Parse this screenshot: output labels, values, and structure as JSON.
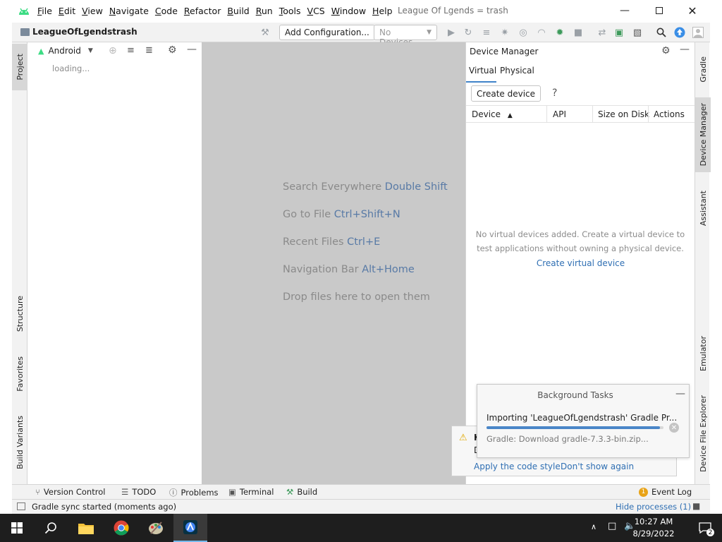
{
  "window": {
    "title": "League Of Lgends = trash",
    "menu": [
      "File",
      "Edit",
      "View",
      "Navigate",
      "Code",
      "Refactor",
      "Build",
      "Run",
      "Tools",
      "VCS",
      "Window",
      "Help"
    ],
    "min_icon": "minimize-icon",
    "max_icon": "maximize-icon",
    "close_icon": "close-icon"
  },
  "toolbar": {
    "project_name": "LeagueOfLgendstrash",
    "add_configuration": "Add Configuration...",
    "device_selector": "No Devices"
  },
  "left_stripe": {
    "project_tab": "Project",
    "structure_tab": "Structure",
    "favorites_tab": "Favorites",
    "build_variants_tab": "Build Variants"
  },
  "project_panel": {
    "view_mode": "Android",
    "loading": "loading..."
  },
  "editor": {
    "hints": [
      {
        "text": "Search Everywhere",
        "key": "Double Shift"
      },
      {
        "text": "Go to File",
        "key": "Ctrl+Shift+N"
      },
      {
        "text": "Recent Files",
        "key": "Ctrl+E"
      },
      {
        "text": "Navigation Bar",
        "key": "Alt+Home"
      },
      {
        "text": "Drop files here to open them",
        "key": ""
      }
    ]
  },
  "device_manager": {
    "title": "Device Manager",
    "tabs": [
      "Virtual",
      "Physical"
    ],
    "create_button": "Create device",
    "help": "?",
    "columns": [
      "Device",
      "API",
      "Size on Disk",
      "Actions"
    ],
    "empty_message": "No virtual devices added. Create a virtual device to test applications without owning a physical device.",
    "empty_link": "Create virtual device"
  },
  "right_stripe": {
    "gradle_tab": "Gradle",
    "device_manager_tab": "Device Manager",
    "assistant_tab": "Assistant",
    "emulator_tab": "Emulator",
    "device_file_explorer_tab": "Device File Explorer"
  },
  "notification": {
    "title_fragment": "K",
    "body_fragment": "D",
    "apply_link": "Apply the code style",
    "dont_show_link": "Don't show again"
  },
  "background_tasks": {
    "title": "Background Tasks",
    "task": "Importing 'LeagueOfLgendstrash' Gradle Pr...",
    "progress": 0.98,
    "detail": "Gradle: Download gradle-7.3.3-bin.zip..."
  },
  "bottom_bar": {
    "version_control": "Version Control",
    "todo": "TODO",
    "problems": "Problems",
    "terminal": "Terminal",
    "build": "Build",
    "event_log": "Event Log",
    "event_log_count": "1"
  },
  "status_bar": {
    "message": "Gradle sync started (moments ago)",
    "hide_processes": "Hide processes (1)"
  },
  "taskbar": {
    "time": "10:27 AM",
    "date": "8/29/2022",
    "notification_count": "2"
  },
  "colors": {
    "accent": "#4083c9",
    "link": "#2f6fb3",
    "editor_bg": "#c9c9c9",
    "taskbar": "#1e1e1e"
  }
}
